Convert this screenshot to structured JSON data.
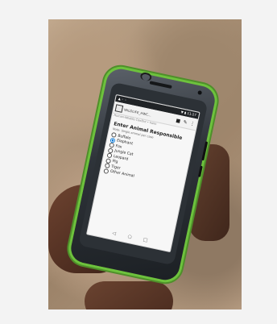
{
  "page": {
    "background": "#f3f3f3"
  },
  "photo": {
    "description_colors": {
      "ground": "#b29579",
      "skin": "#5c3827",
      "phone_accent": "#6dc23d"
    }
  },
  "phone": {
    "status_left": "▲ ◦ ◦",
    "status_right": "▼ ▮ 11:27",
    "app_title": "WILDLIFE_HWC...",
    "subtitle": "Human-Wildlife Conflict  •  Form",
    "icons": [
      "document-icon",
      "save-icon",
      "edit-icon",
      "more-icon"
    ],
    "question": "Enter Animal Responsible",
    "hint": "Note: Single animal per case",
    "options": [
      {
        "label": "Buffalo",
        "selected": false
      },
      {
        "label": "Elephant",
        "selected": true
      },
      {
        "label": "Fox",
        "selected": false
      },
      {
        "label": "Jungle Cat",
        "selected": false
      },
      {
        "label": "Leopard",
        "selected": false
      },
      {
        "label": "Pig",
        "selected": false
      },
      {
        "label": "Tiger",
        "selected": false
      },
      {
        "label": "Other Animal",
        "selected": false
      }
    ],
    "nav": [
      "◁",
      "○",
      "□"
    ]
  }
}
